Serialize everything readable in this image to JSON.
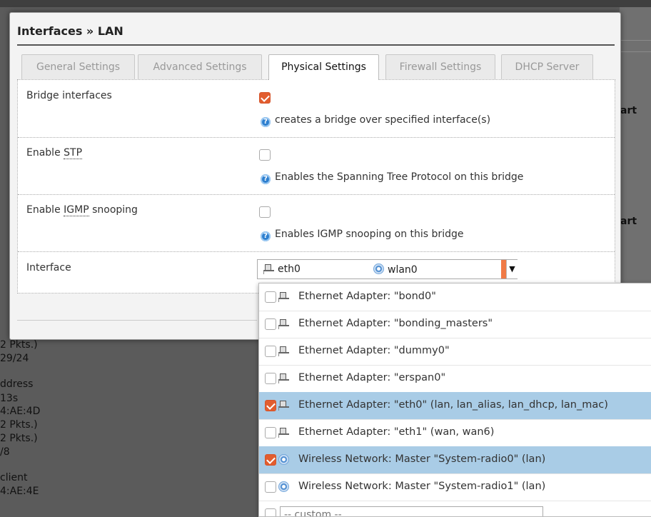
{
  "background": {
    "right_labels": [
      "art",
      "art"
    ],
    "left_lines": [
      "2 Pkts.)",
      "29/24",
      "ddress",
      "13s",
      "4:AE:4D",
      "2 Pkts.)",
      "2 Pkts.)",
      "/8",
      "client",
      "4:AE:4E"
    ]
  },
  "modal": {
    "title": "Interfaces » LAN",
    "tabs": [
      "General Settings",
      "Advanced Settings",
      "Physical Settings",
      "Firewall Settings",
      "DHCP Server"
    ],
    "active_tab": "Physical Settings"
  },
  "fields": {
    "bridge": {
      "label": "Bridge interfaces",
      "checked": true,
      "help": "creates a bridge over specified interface(s)"
    },
    "stp": {
      "label_prefix": "Enable ",
      "abbr": "STP",
      "label_suffix": "",
      "checked": false,
      "help": "Enables the Spanning Tree Protocol on this bridge"
    },
    "igmp": {
      "label_prefix": "Enable ",
      "abbr": "IGMP",
      "label_suffix": " snooping",
      "checked": false,
      "help": "Enables IGMP snooping on this bridge"
    },
    "interface": {
      "label": "Interface",
      "selected": [
        "eth0",
        "wlan0"
      ]
    }
  },
  "help_icon_glyph": "?",
  "caret_glyph": "▼",
  "dropdown": {
    "items": [
      {
        "icon": "ethernet-icon",
        "label": "Ethernet Adapter: \"bond0\"",
        "checked": false,
        "selected": false
      },
      {
        "icon": "ethernet-icon",
        "label": "Ethernet Adapter: \"bonding_masters\"",
        "checked": false,
        "selected": false
      },
      {
        "icon": "ethernet-icon",
        "label": "Ethernet Adapter: \"dummy0\"",
        "checked": false,
        "selected": false
      },
      {
        "icon": "ethernet-icon",
        "label": "Ethernet Adapter: \"erspan0\"",
        "checked": false,
        "selected": false
      },
      {
        "icon": "ethernet-icon",
        "label": "Ethernet Adapter: \"eth0\" (lan, lan_alias, lan_dhcp, lan_mac)",
        "checked": true,
        "selected": true
      },
      {
        "icon": "ethernet-icon",
        "label": "Ethernet Adapter: \"eth1\" (wan, wan6)",
        "checked": false,
        "selected": false
      },
      {
        "icon": "wireless-icon",
        "label": "Wireless Network: Master \"System-radio0\" (lan)",
        "checked": true,
        "selected": true
      },
      {
        "icon": "wireless-icon",
        "label": "Wireless Network: Master \"System-radio1\" (lan)",
        "checked": false,
        "selected": false
      }
    ],
    "custom_placeholder": "-- custom --"
  },
  "colors": {
    "accent": "#e25d2f",
    "selected_row": "#a9cce6",
    "help_icon": "#2d7fcf"
  }
}
